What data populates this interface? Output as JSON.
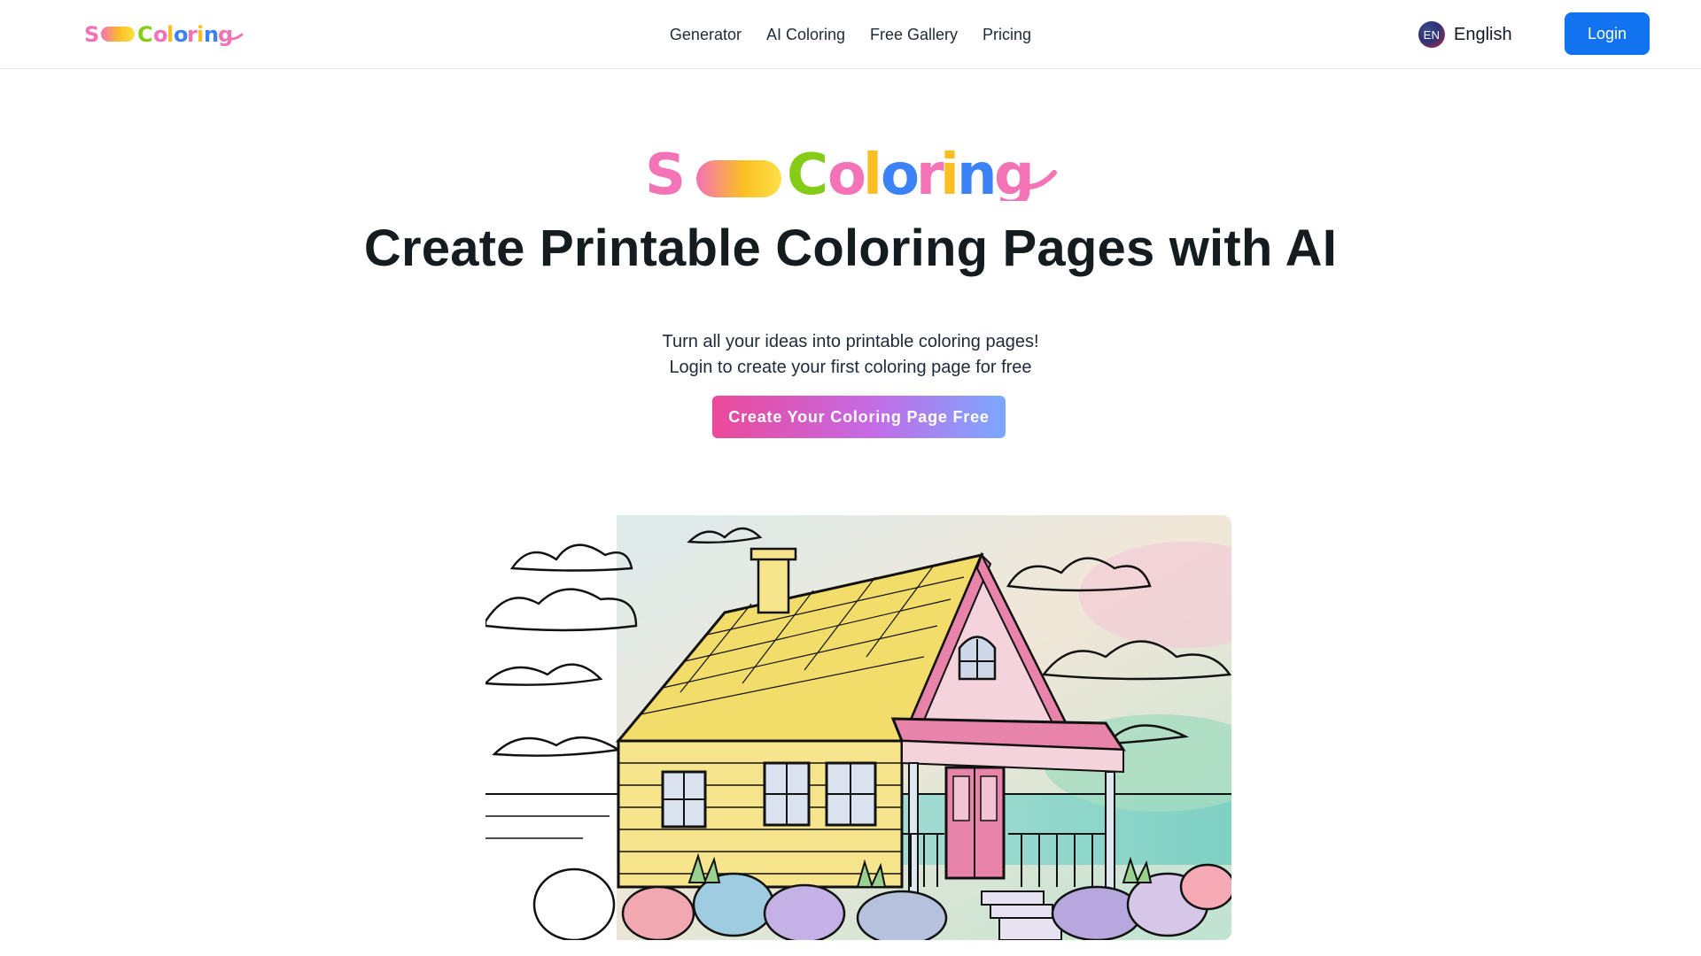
{
  "header": {
    "brand": "SoColoring",
    "nav": [
      {
        "label": "Generator"
      },
      {
        "label": "AI Coloring"
      },
      {
        "label": "Free Gallery"
      },
      {
        "label": "Pricing"
      }
    ],
    "language": {
      "code": "EN",
      "label": "English"
    },
    "login_label": "Login"
  },
  "hero": {
    "logo_text": "SoColoring",
    "title": "Create Printable Coloring Pages with AI",
    "subtitle_line1": "Turn all your ideas into printable coloring pages!",
    "subtitle_line2": "Login to create your first coloring page for free",
    "cta_label": "Create Your Coloring Page Free"
  },
  "colors": {
    "primary_button": "#1173f0",
    "cta_gradient_start": "#ec4899",
    "cta_gradient_end": "#7aa8ff",
    "title_text": "#151c1f"
  },
  "illustration": {
    "subject": "house-coloring-page-icon"
  }
}
